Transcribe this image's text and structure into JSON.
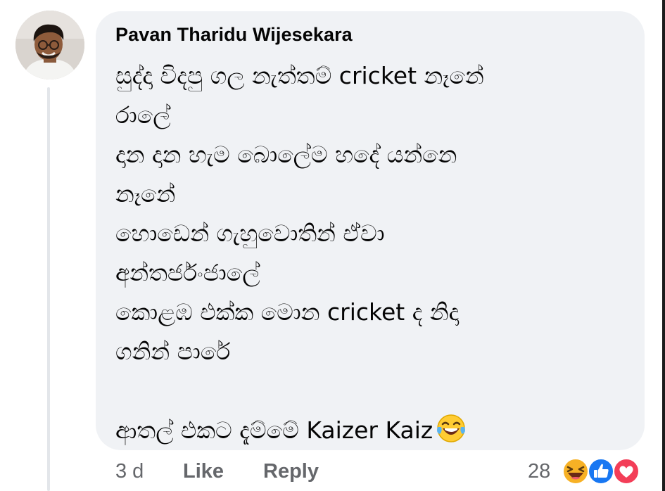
{
  "comment": {
    "author": "Pavan Tharidu Wijesekara",
    "lines": [
      "සුද්දා විදපු ගල නැත්තම් cricket නෑනේ",
      "රාලේ",
      "දාන දාන හැම බොලේම හදේ යන්නෙ",
      "නෑනේ",
      "හොඩෙන් ගැහුවොතින් ඒවා",
      "අන්තර්ජංජාලේ",
      "කොළඹ එක්ක මොන cricket ද නිදා",
      "ගනින් පාරේ"
    ],
    "last_line": "ආතල් එකට දැම්මේ Kaizer Kaiz",
    "last_line_emoji": "laughing-tears-emoji"
  },
  "footer": {
    "time": "3 d",
    "like_label": "Like",
    "reply_label": "Reply"
  },
  "reactions": {
    "count": "28",
    "icons": [
      "haha-reaction-icon",
      "like-reaction-icon",
      "love-reaction-icon"
    ]
  },
  "colors": {
    "bubble_bg": "#f0f2f5",
    "text_primary": "#050505",
    "text_secondary": "#65676b",
    "like_blue": "#1877f2",
    "love_red": "#f33e58",
    "haha_yellow": "#f7b125"
  }
}
